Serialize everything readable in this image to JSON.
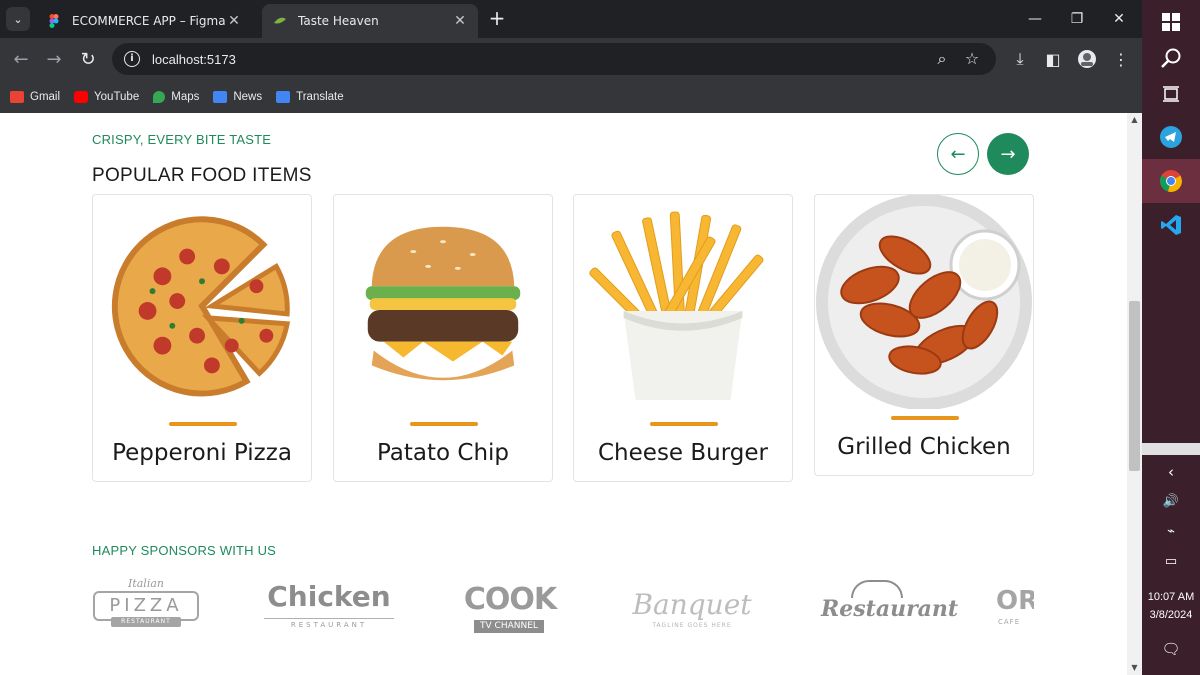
{
  "browser": {
    "tabs": [
      {
        "title": "ECOMMERCE APP – Figma",
        "active": false
      },
      {
        "title": "Taste Heaven",
        "active": true
      }
    ],
    "new_tab": "+",
    "url": "localhost:5173",
    "bookmarks": [
      {
        "label": "Gmail",
        "icon": "gmail-icon",
        "color": "#ea4335"
      },
      {
        "label": "YouTube",
        "icon": "youtube-icon",
        "color": "#ff0000"
      },
      {
        "label": "Maps",
        "icon": "maps-icon",
        "color": "#34a853"
      },
      {
        "label": "News",
        "icon": "news-icon",
        "color": "#4285f4"
      },
      {
        "label": "Translate",
        "icon": "translate-icon",
        "color": "#4285f4"
      }
    ]
  },
  "page": {
    "eyebrow": "CRISPY, EVERY BITE TASTE",
    "title": "POPULAR FOOD ITEMS",
    "prev_label": "←",
    "next_label": "→",
    "accent": "#1f8a5b",
    "bar_color": "#e8951c",
    "items": [
      {
        "name": "Pepperoni Pizza",
        "icon": "pizza-image"
      },
      {
        "name": "Patato Chip",
        "icon": "burger-image"
      },
      {
        "name": "Cheese Burger",
        "icon": "fries-image"
      },
      {
        "name": "Grilled Chicken",
        "icon": "chicken-wings-image"
      }
    ],
    "sponsors_title": "HAPPY SPONSORS WITH US",
    "sponsors": [
      {
        "top": "Italian",
        "main": "PIZZA",
        "sub": "RESTAURANT"
      },
      {
        "main": "Chicken",
        "sub": "RESTAURANT"
      },
      {
        "main": "COOK",
        "sub": "TV CHANNEL"
      },
      {
        "main": "Banquet",
        "sub": "TAGLINE GOES HERE"
      },
      {
        "main": "Restaurant"
      },
      {
        "main": "OR",
        "sub": "CAFE"
      }
    ]
  },
  "taskbar": {
    "time": "10:07 AM",
    "date": "3/8/2024"
  }
}
